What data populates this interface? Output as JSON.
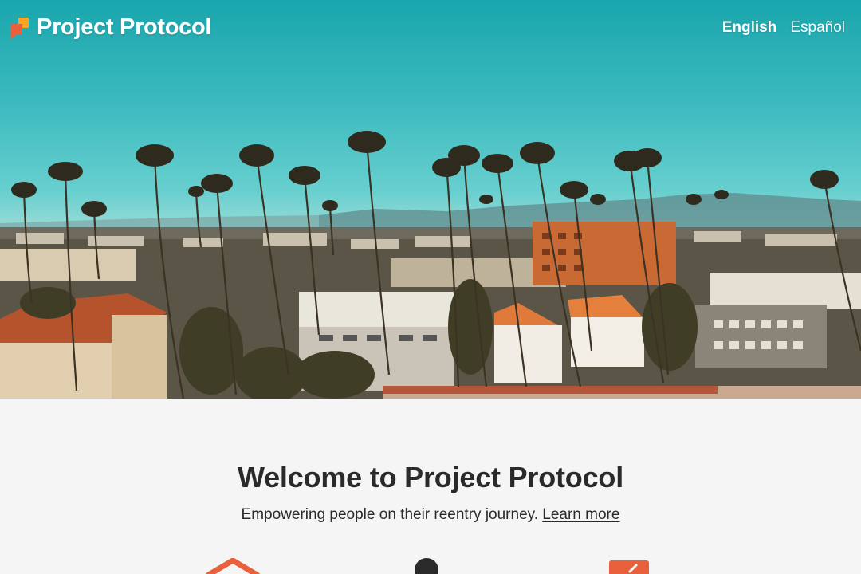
{
  "header": {
    "brand_name": "Project Protocol",
    "logo_icon": "speech-bubble-logo-icon",
    "languages": [
      {
        "label": "English",
        "active": true
      },
      {
        "label": "Español",
        "active": false
      }
    ]
  },
  "hero": {
    "image": "aerial photo of city with palm trees and apartment buildings under teal sky"
  },
  "main": {
    "title": "Welcome to Project Protocol",
    "tagline": "Empowering people on their reentry journey.",
    "learn_more": "Learn more"
  },
  "feature_icons": [
    "house-icon",
    "person-icon",
    "checklist-icon"
  ],
  "colors": {
    "brand_orange": "#e8603c",
    "text_dark": "#2a2a2a",
    "background": "#f5f5f5",
    "sky_teal": "#19a6ad"
  }
}
